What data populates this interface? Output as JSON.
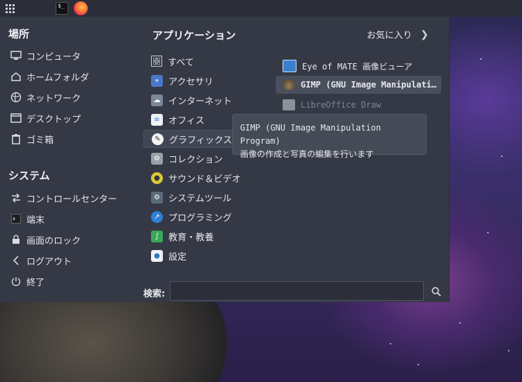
{
  "panel": {
    "terminal_glyph": "$_"
  },
  "places": {
    "title": "場所",
    "items": [
      {
        "label": "コンピュータ",
        "icon": "monitor-icon"
      },
      {
        "label": "ホームフォルダ",
        "icon": "home-icon"
      },
      {
        "label": "ネットワーク",
        "icon": "network-icon"
      },
      {
        "label": "デスクトップ",
        "icon": "desktop-icon"
      },
      {
        "label": "ゴミ箱",
        "icon": "trash-icon"
      }
    ]
  },
  "system": {
    "title": "システム",
    "items": [
      {
        "label": "コントロールセンター",
        "icon": "control-center-icon"
      },
      {
        "label": "端末",
        "icon": "terminal-icon"
      },
      {
        "label": "画面のロック",
        "icon": "lock-icon"
      },
      {
        "label": "ログアウト",
        "icon": "logout-icon"
      },
      {
        "label": "終了",
        "icon": "power-icon"
      }
    ]
  },
  "applications": {
    "title": "アプリケーション",
    "favorites_label": "お気に入り",
    "categories": [
      {
        "label": "すべて",
        "icon": "all-apps-icon",
        "color": "#3a3e4a"
      },
      {
        "label": "アクセサリ",
        "icon": "accessories-icon",
        "color": "#4a78c8"
      },
      {
        "label": "インターネット",
        "icon": "internet-icon",
        "color": "#7a8898"
      },
      {
        "label": "オフィス",
        "icon": "office-icon",
        "color": "#3b7fd1"
      },
      {
        "label": "グラフィックス",
        "icon": "graphics-icon",
        "color": "#e8e8e8"
      },
      {
        "label": "コレクション",
        "icon": "collection-icon",
        "color": "#9aa0a8"
      },
      {
        "label": "サウンド＆ビデオ",
        "icon": "sound-video-icon",
        "color": "#d8c83a"
      },
      {
        "label": "システムツール",
        "icon": "system-tools-icon",
        "color": "#5a6a7a"
      },
      {
        "label": "プログラミング",
        "icon": "programming-icon",
        "color": "#2f7ed8"
      },
      {
        "label": "教育・教養",
        "icon": "education-icon",
        "color": "#3aa858"
      },
      {
        "label": "設定",
        "icon": "settings-icon",
        "color": "#2a7ac0"
      }
    ],
    "selected_category": 4,
    "apps": [
      {
        "label": "Eye of MATE 画像ビューア",
        "icon": "image-viewer-icon",
        "color": "#3a7fd0"
      },
      {
        "label": "GIMP (GNU Image Manipulati…",
        "icon": "gimp-icon",
        "color": "#6e5a3a"
      },
      {
        "label": "LibreOffice Draw",
        "icon": "libreoffice-draw-icon",
        "color": "#c0c8d0"
      }
    ]
  },
  "tooltip": {
    "line1": "GIMP (GNU Image Manipulation Program)",
    "line2": "画像の作成と写真の編集を行います"
  },
  "search": {
    "label": "検索:",
    "value": "",
    "placeholder": ""
  }
}
